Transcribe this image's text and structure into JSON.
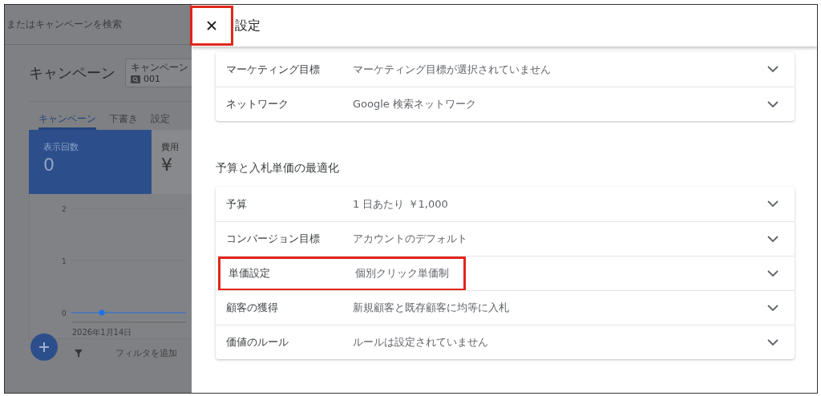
{
  "background": {
    "search_placeholder": "またはキャンペーンを検索",
    "title": "キャンペーン",
    "campaign_chip": {
      "label": "キャンペーン",
      "value": "001"
    },
    "tabs": [
      {
        "label": "キャンペーン",
        "selected": true
      },
      {
        "label": "下書き",
        "selected": false
      },
      {
        "label": "設定",
        "selected": false
      }
    ],
    "metrics": [
      {
        "label": "表示回数",
        "value": "0",
        "selected": true
      },
      {
        "label": "費用",
        "value": "¥",
        "selected": false
      }
    ],
    "chart_data": {
      "type": "line",
      "categories": [
        "2026年1月14日"
      ],
      "ylim": [
        0,
        2
      ],
      "yticks": [
        0,
        1,
        2
      ],
      "series": [
        {
          "color": "#1a73e8",
          "marker": "circle",
          "values": [
            0
          ]
        }
      ]
    },
    "filter_label": "フィルタを追加"
  },
  "dialog": {
    "title": "設定",
    "close_highlighted": true,
    "groups": [
      {
        "rows": [
          {
            "label": "マーケティング目標",
            "value": "マーケティング目標が選択されていません",
            "highlighted": false
          },
          {
            "label": "ネットワーク",
            "value": "Google 検索ネットワーク",
            "highlighted": false
          }
        ]
      },
      {
        "heading": "予算と入札単価の最適化",
        "rows": [
          {
            "label": "予算",
            "value": "1 日あたり ￥1,000",
            "highlighted": false
          },
          {
            "label": "コンバージョン目標",
            "value": "アカウントのデフォルト",
            "highlighted": false
          },
          {
            "label": "単価設定",
            "value": "個別クリック単価制",
            "highlighted": true
          },
          {
            "label": "顧客の獲得",
            "value": "新規顧客と既存顧客に均等に入札",
            "highlighted": false
          },
          {
            "label": "価値のルール",
            "value": "ルールは設定されていません",
            "highlighted": false
          }
        ]
      }
    ]
  }
}
